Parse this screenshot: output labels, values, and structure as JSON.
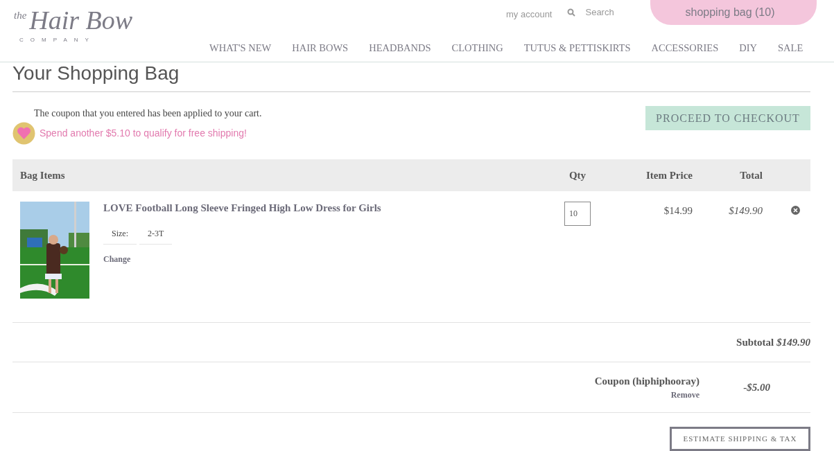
{
  "logo": {
    "small": "the",
    "main": "Hair Bow",
    "sub": "COMPANY"
  },
  "top_links": {
    "account": "my account",
    "search_placeholder": "Search",
    "bag": "shopping bag (10)"
  },
  "nav": [
    "WHAT'S NEW",
    "HAIR BOWS",
    "HEADBANDS",
    "CLOTHING",
    "TUTUS & PETTISKIRTS",
    "ACCESSORIES",
    "DIY",
    "SALE"
  ],
  "page_title": "Your Shopping Bag",
  "coupon_message": "The coupon that you entered has been applied to your cart.",
  "shipping_message": "Spend another $5.10 to qualify for free shipping!",
  "checkout_button": "PROCEED TO CHECKOUT",
  "table": {
    "columns": [
      "Bag Items",
      "Qty",
      "Item Price",
      "Total"
    ],
    "rows": [
      {
        "name": "LOVE Football Long Sleeve Fringed High Low Dress for Girls",
        "option_label": "Size:",
        "option_value": "2-3T",
        "change": "Change",
        "qty": "10",
        "price": "$14.99",
        "total": "$149.90"
      }
    ]
  },
  "subtotal": {
    "label": "Subtotal",
    "value": "$149.90"
  },
  "coupon": {
    "label": "Coupon (hiphiphooray)",
    "remove": "Remove",
    "value": "-$5.00"
  },
  "estimate_button": "ESTIMATE SHIPPING & TAX"
}
